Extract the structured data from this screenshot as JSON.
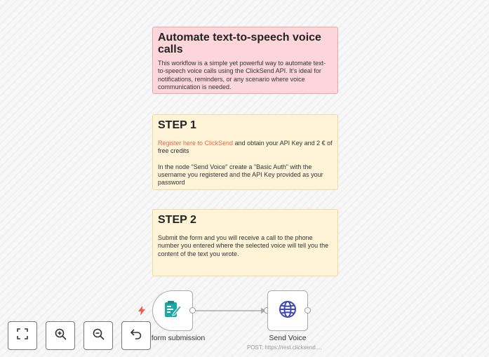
{
  "notes": {
    "intro": {
      "title": "Automate text-to-speech voice calls",
      "body": "This workflow is a simple yet powerful way to automate text-to-speech voice calls using the ClickSend API. It's ideal for notifications, reminders, or any scenario where voice communication is needed."
    },
    "step1": {
      "title": "STEP 1",
      "link_text": "Register here to ClickSend",
      "body1_rest": " and obtain your API Key and 2 € of free credits",
      "body2": "In the node \"Send Voice\" create a \"Basic Auth\" with the username you registered and the API Key provided as your password"
    },
    "step2": {
      "title": "STEP 2",
      "body": "Submit the form and you will receive a call to the phone number you entered where the selected voice will tell you the content of the text you wrote."
    }
  },
  "nodes": {
    "trigger": {
      "label": "form submission",
      "icon": "form-icon",
      "badge_icon": "lightning-icon"
    },
    "action": {
      "label": "Send Voice",
      "subtitle": "POST: https://rest.clicksend....",
      "icon": "globe-icon"
    }
  },
  "controls": [
    {
      "icon": "fit-view-icon"
    },
    {
      "icon": "zoom-in-icon"
    },
    {
      "icon": "zoom-out-icon"
    },
    {
      "icon": "undo-icon"
    }
  ],
  "colors": {
    "intro_note": "#fdd6dc",
    "step_note": "#fff4d7",
    "link": "#e8664f",
    "trigger_icon": "#1aa8a8",
    "action_icon": "#3d47b5",
    "lightning": "#f05a4f"
  }
}
